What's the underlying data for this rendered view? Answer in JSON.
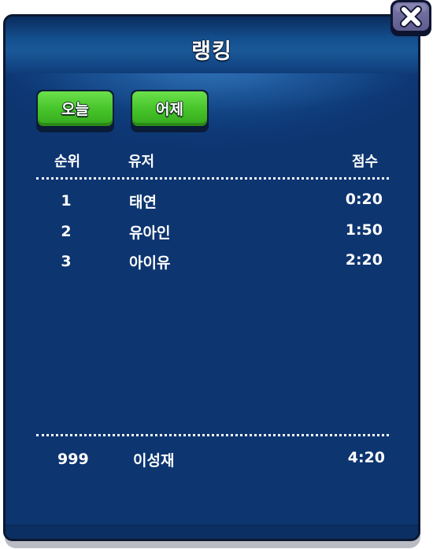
{
  "title": "랭킹",
  "close_icon": "close-x-icon",
  "tabs": [
    {
      "label": "오늘"
    },
    {
      "label": "어제"
    }
  ],
  "columns": {
    "rank": "순위",
    "user": "유저",
    "score": "점수"
  },
  "rows": [
    {
      "rank": "1",
      "user": "태연",
      "score": "0:20"
    },
    {
      "rank": "2",
      "user": "유아인",
      "score": "1:50"
    },
    {
      "rank": "3",
      "user": "아이유",
      "score": "2:20"
    }
  ],
  "my_row": {
    "rank": "999",
    "user": "이성재",
    "score": "4:20"
  },
  "colors": {
    "panel": "#0d3570",
    "tab_green": "#44c228",
    "close_button": "#6a689a",
    "text": "#ffffff"
  }
}
